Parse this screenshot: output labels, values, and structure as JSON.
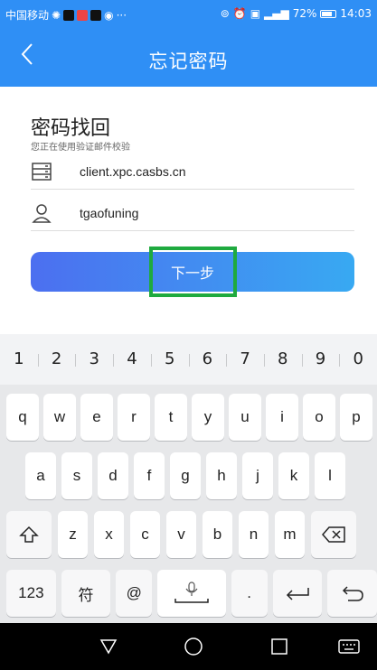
{
  "status_bar": {
    "carrier": "中国移动",
    "battery": "72%",
    "time": "14:03"
  },
  "header": {
    "back_glyph": "〈",
    "title": "忘记密码"
  },
  "form": {
    "heading": "密码找回",
    "subtitle": "您正在使用验证邮件校验",
    "server_value": "client.xpc.casbs.cn",
    "server_icon": "server-icon",
    "username_value": "tgaofuning",
    "username_icon": "user-icon",
    "next_button": "下一步",
    "highlight_color": "#1faa3f"
  },
  "keyboard": {
    "numbers": [
      "1",
      "2",
      "3",
      "4",
      "5",
      "6",
      "7",
      "8",
      "9",
      "0"
    ],
    "row1": [
      "q",
      "w",
      "e",
      "r",
      "t",
      "y",
      "u",
      "i",
      "o",
      "p"
    ],
    "row2": [
      "a",
      "s",
      "d",
      "f",
      "g",
      "h",
      "j",
      "k",
      "l"
    ],
    "row3": [
      "z",
      "x",
      "c",
      "v",
      "b",
      "n",
      "m"
    ],
    "key_123": "123",
    "key_symbol": "符",
    "key_at": "@",
    "key_period": "."
  },
  "nav_bar": {
    "back": "back-triangle-icon",
    "home": "home-circle-icon",
    "recents": "recents-square-icon",
    "keyboard": "keyboard-icon"
  },
  "colors": {
    "primary": "#2f8ff5",
    "button_start": "#4c6ff0",
    "button_end": "#38a9f2"
  }
}
